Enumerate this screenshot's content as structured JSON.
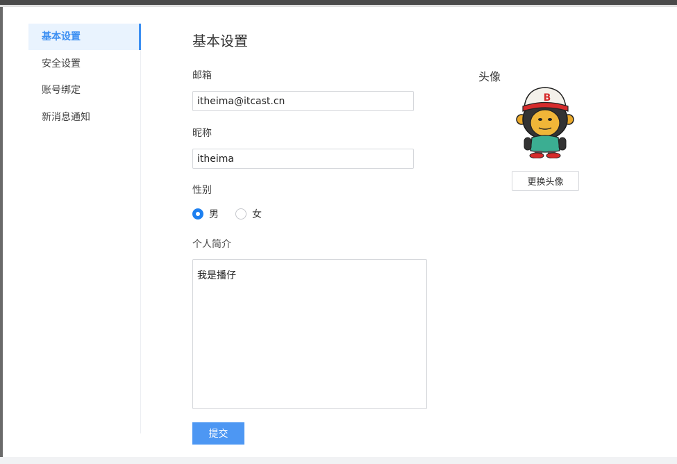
{
  "sidebar": {
    "items": [
      {
        "label": "基本设置",
        "active": true
      },
      {
        "label": "安全设置",
        "active": false
      },
      {
        "label": "账号绑定",
        "active": false
      },
      {
        "label": "新消息通知",
        "active": false
      }
    ]
  },
  "main": {
    "title": "基本设置",
    "email": {
      "label": "邮箱",
      "value": "itheima@itcast.cn"
    },
    "nickname": {
      "label": "昵称",
      "value": "itheima"
    },
    "gender": {
      "label": "性别",
      "options": [
        {
          "label": "男",
          "checked": true
        },
        {
          "label": "女",
          "checked": false
        }
      ]
    },
    "bio": {
      "label": "个人简介",
      "value": "我是播仔"
    },
    "submit_label": "提交"
  },
  "avatar": {
    "label": "头像",
    "badge_letter": "B",
    "change_label": "更换头像"
  },
  "colors": {
    "accent": "#3c8ff2",
    "active_bg": "#e9f3fe",
    "submit_bg": "#4d97f3",
    "radio_checked": "#1e80f0"
  }
}
